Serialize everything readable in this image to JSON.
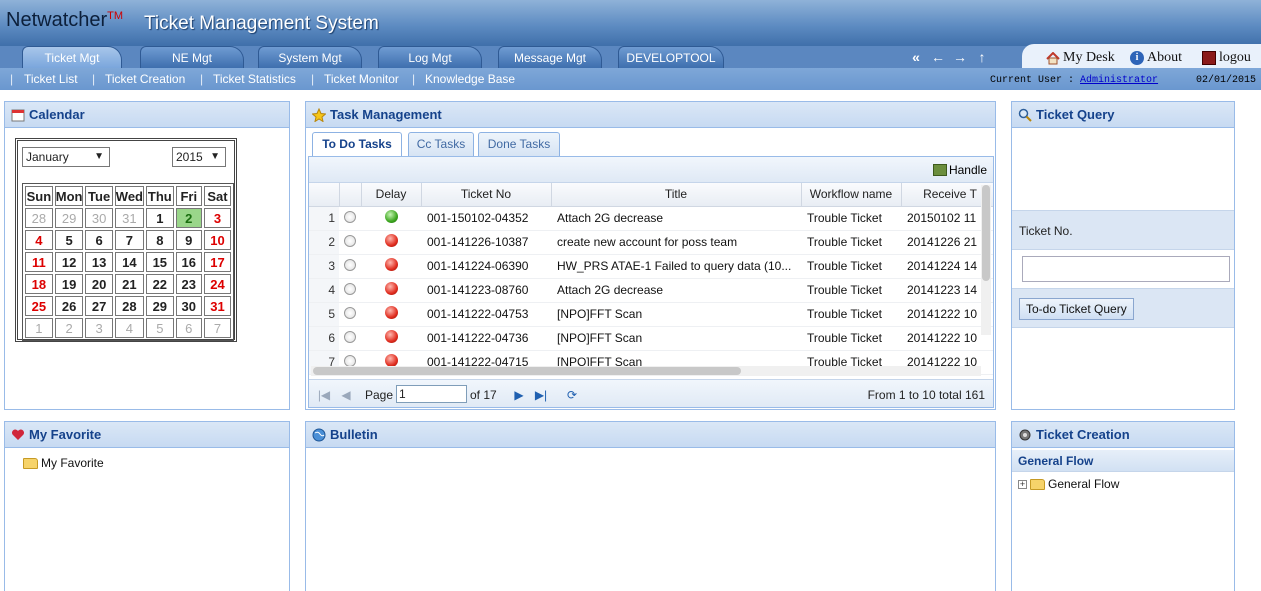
{
  "app": {
    "brand": "Netwatcher",
    "brand_mark": "TM",
    "title": "Ticket Management System"
  },
  "main_tabs": [
    "Ticket Mgt",
    "NE Mgt",
    "System Mgt",
    "Log Mgt",
    "Message Mgt",
    "DEVELOPTOOL"
  ],
  "user_links": {
    "mydesk": "My Desk",
    "about": "About",
    "logout": "logou"
  },
  "sub_nav": [
    "Ticket List",
    "Ticket Creation",
    "Ticket Statistics",
    "Ticket Monitor",
    "Knowledge Base"
  ],
  "current_user": {
    "label": "Current User :",
    "name": "Administrator"
  },
  "date": "02/01/2015",
  "calendar": {
    "title": "Calendar",
    "month": "January",
    "year": "2015",
    "days": [
      "Sun",
      "Mon",
      "Tue",
      "Wed",
      "Thu",
      "Fri",
      "Sat"
    ],
    "weeks": [
      [
        "28",
        "29",
        "30",
        "31",
        "1",
        "2",
        "3"
      ],
      [
        "4",
        "5",
        "6",
        "7",
        "8",
        "9",
        "10"
      ],
      [
        "11",
        "12",
        "13",
        "14",
        "15",
        "16",
        "17"
      ],
      [
        "18",
        "19",
        "20",
        "21",
        "22",
        "23",
        "24"
      ],
      [
        "25",
        "26",
        "27",
        "28",
        "29",
        "30",
        "31"
      ],
      [
        "1",
        "2",
        "3",
        "4",
        "5",
        "6",
        "7"
      ]
    ]
  },
  "task": {
    "title": "Task Management",
    "tabs": [
      "To Do Tasks",
      "Cc Tasks",
      "Done Tasks"
    ],
    "handle": "Handle",
    "columns": [
      "Delay",
      "Ticket No",
      "Title",
      "Workflow name",
      "Receive T"
    ],
    "rows": [
      {
        "n": "1",
        "delay": "green",
        "ticket": "001-150102-04352",
        "title": "Attach 2G decrease",
        "wf": "Trouble Ticket",
        "recv": "20150102 11"
      },
      {
        "n": "2",
        "delay": "red",
        "ticket": "001-141226-10387",
        "title": "create new account for poss team",
        "wf": "Trouble Ticket",
        "recv": "20141226 21"
      },
      {
        "n": "3",
        "delay": "red",
        "ticket": "001-141224-06390",
        "title": "HW_PRS ATAE-1 Failed to query data (10...",
        "wf": "Trouble Ticket",
        "recv": "20141224 14"
      },
      {
        "n": "4",
        "delay": "red",
        "ticket": "001-141223-08760",
        "title": "Attach 2G decrease",
        "wf": "Trouble Ticket",
        "recv": "20141223 14"
      },
      {
        "n": "5",
        "delay": "red",
        "ticket": "001-141222-04753",
        "title": "[NPO]FFT Scan",
        "wf": "Trouble Ticket",
        "recv": "20141222 10"
      },
      {
        "n": "6",
        "delay": "red",
        "ticket": "001-141222-04736",
        "title": "[NPO]FFT Scan",
        "wf": "Trouble Ticket",
        "recv": "20141222 10"
      },
      {
        "n": "7",
        "delay": "red",
        "ticket": "001-141222-04715",
        "title": "[NPO]FFT Scan",
        "wf": "Trouble Ticket",
        "recv": "20141222 10"
      }
    ],
    "pager": {
      "page_label": "Page",
      "page": "1",
      "of": "of 17",
      "summary": "From 1 to 10 total 161"
    }
  },
  "query": {
    "title": "Ticket Query",
    "label": "Ticket No.",
    "button": "To-do Ticket Query"
  },
  "favorite": {
    "title": "My Favorite",
    "item": "My Favorite"
  },
  "bulletin": {
    "title": "Bulletin"
  },
  "creation": {
    "title": "Ticket Creation",
    "group": "General Flow",
    "item": "General Flow"
  }
}
